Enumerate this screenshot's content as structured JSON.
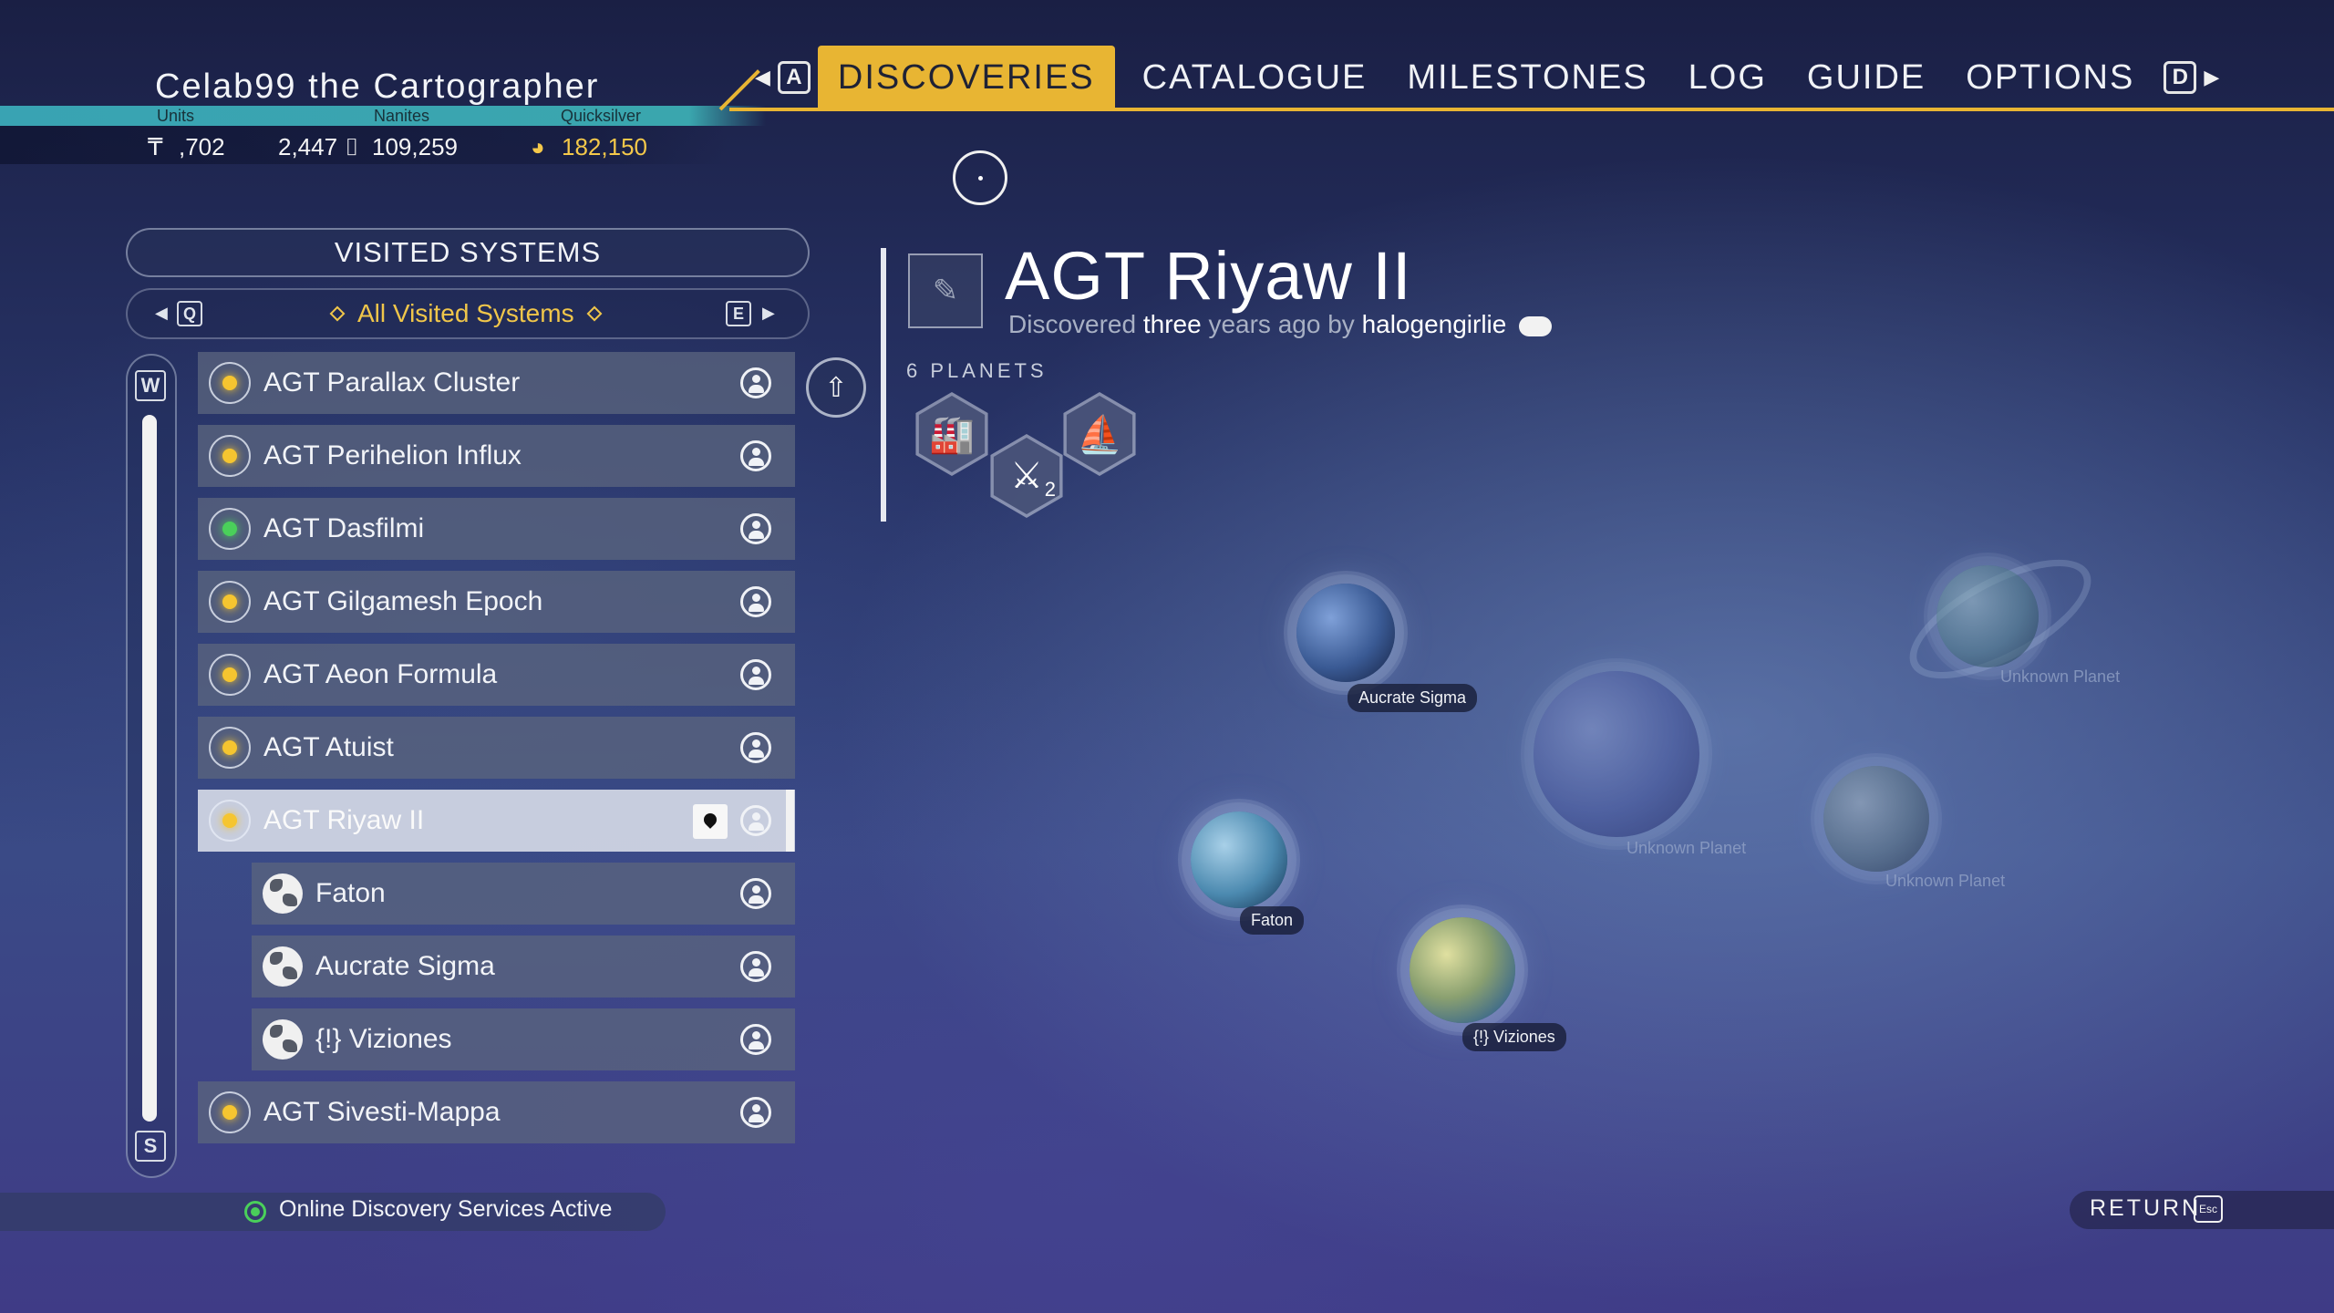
{
  "player": {
    "name": "Celab99 the Cartographer",
    "currencies": [
      {
        "label": "Units",
        "value": ",702",
        "icon": "units-icon"
      },
      {
        "label": "Nanites",
        "value": "2,447",
        "icon": "nanites-icon"
      },
      {
        "label": "",
        "value": "109,259",
        "icon": "nanites-icon"
      },
      {
        "label": "Quicksilver",
        "value": "182,150",
        "icon": "quicksilver-icon"
      }
    ]
  },
  "nav": {
    "prev_key": "A",
    "next_key": "D",
    "tabs": [
      "DISCOVERIES",
      "CATALOGUE",
      "MILESTONES",
      "LOG",
      "GUIDE",
      "OPTIONS"
    ],
    "active_tab": "DISCOVERIES"
  },
  "left_panel": {
    "header": "VISITED SYSTEMS",
    "filter": {
      "prev_key": "Q",
      "next_key": "E",
      "label": "All Visited Systems"
    },
    "scroll_up_key": "W",
    "scroll_down_key": "S",
    "items": [
      {
        "label": "AGT Parallax Cluster",
        "type": "system",
        "star": "yellow"
      },
      {
        "label": "AGT Perihelion Influx",
        "type": "system",
        "star": "yellow"
      },
      {
        "label": "AGT Dasfilmi",
        "type": "system",
        "star": "green"
      },
      {
        "label": "AGT Gilgamesh Epoch",
        "type": "system",
        "star": "yellow"
      },
      {
        "label": "AGT Aeon Formula",
        "type": "system",
        "star": "yellow"
      },
      {
        "label": "AGT Atuist",
        "type": "system",
        "star": "yellow"
      },
      {
        "label": "AGT Riyaw II",
        "type": "system",
        "star": "yellow",
        "selected": true
      },
      {
        "label": "Faton",
        "type": "planet"
      },
      {
        "label": "Aucrate Sigma",
        "type": "planet"
      },
      {
        "label": "{!} Viziones",
        "type": "planet"
      },
      {
        "label": "AGT Sivesti-Mappa",
        "type": "system",
        "star": "yellow"
      }
    ]
  },
  "status": {
    "online_text": "Online Discovery Services Active"
  },
  "detail": {
    "title": "AGT Riyaw II",
    "discovered_prefix": "Discovered",
    "discovered_when_hl": "three",
    "discovered_when_rest": "years ago by",
    "discoverer": "halogengirlie",
    "planets_label": "6 PLANETS",
    "fauna_badge_count": "2",
    "map_planets": [
      {
        "name": "Aucrate Sigma",
        "known": true
      },
      {
        "name": "Faton",
        "known": true
      },
      {
        "name": "{!} Viziones",
        "known": true
      },
      {
        "name": "Unknown Planet",
        "known": false
      },
      {
        "name": "Unknown Planet",
        "known": false
      },
      {
        "name": "Unknown Planet",
        "known": false
      }
    ]
  },
  "footer": {
    "return_label": "RETURN",
    "return_key": "Esc"
  },
  "colors": {
    "accent": "#e8b533",
    "quicksilver": "#f4c84a",
    "online": "#4ad05a",
    "teal_strip": "#39a3b3"
  }
}
